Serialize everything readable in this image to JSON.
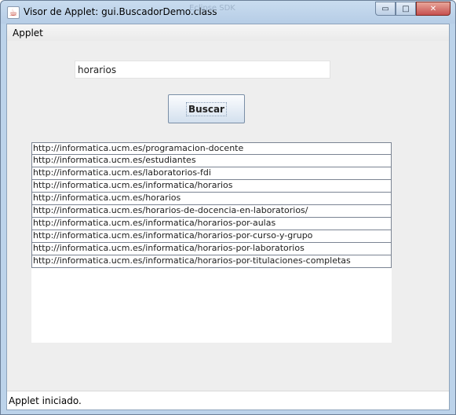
{
  "window": {
    "title": "Visor de Applet: gui.BuscadorDemo.class",
    "background_title": "Eclipse SDK",
    "controls": {
      "minimize": "▭",
      "maximize": "□",
      "close": "✕"
    }
  },
  "menubar": {
    "items": [
      {
        "label": "Applet"
      }
    ]
  },
  "search": {
    "value": "horarios",
    "button_label": "Buscar"
  },
  "results": [
    "http://informatica.ucm.es/programacion-docente",
    "http://informatica.ucm.es/estudiantes",
    "http://informatica.ucm.es/laboratorios-fdi",
    "http://informatica.ucm.es/informatica/horarios",
    "http://informatica.ucm.es/horarios",
    "http://informatica.ucm.es/horarios-de-docencia-en-laboratorios/",
    "http://informatica.ucm.es/informatica/horarios-por-aulas",
    "http://informatica.ucm.es/informatica/horarios-por-curso-y-grupo",
    "http://informatica.ucm.es/informatica/horarios-por-laboratorios",
    "http://informatica.ucm.es/informatica/horarios-por-titulaciones-completas"
  ],
  "status": {
    "text": "Applet iniciado."
  },
  "colors": {
    "titlebar": "#c9dcef",
    "client": "#eeeeee",
    "close": "#c75050"
  },
  "icons": {
    "window": "java-cup-icon"
  }
}
